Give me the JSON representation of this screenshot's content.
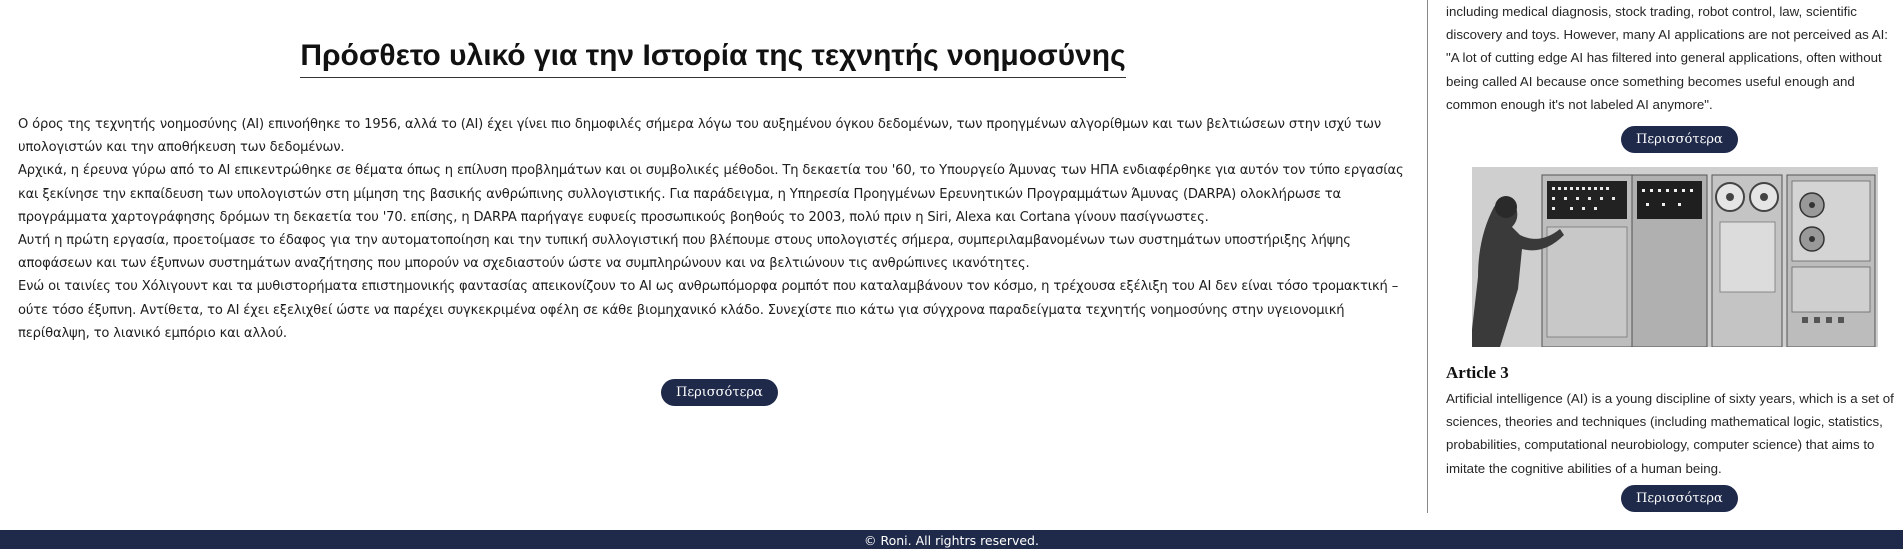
{
  "main": {
    "title": "Πρόσθετο υλικό για την Ιστορία της τεχνητής νοημοσύνης",
    "paragraphs": [
      "Ο όρος της τεχνητής νοημοσύνης (AI) επινοήθηκε το 1956, αλλά το (AI) έχει γίνει πιο δημοφιλές σήμερα λόγω του αυξημένου όγκου δεδομένων, των προηγμένων αλγορίθμων και των βελτιώσεων στην ισχύ των υπολογιστών και την αποθήκευση των δεδομένων.",
      "Αρχικά, η έρευνα γύρω από το AI επικεντρώθηκε σε θέματα όπως η επίλυση προβλημάτων και οι συμβολικές μέθοδοι. Τη δεκαετία του '60, το Υπουργείο Άμυνας των ΗΠΑ ενδιαφέρθηκε για αυτόν τον τύπο εργασίας και ξεκίνησε την εκπαίδευση των υπολογιστών στη μίμηση της βασικής ανθρώπινης συλλογιστικής. Για παράδειγμα, η Υπηρεσία Προηγμένων Ερευνητικών Προγραμμάτων Άμυνας (DARPA) ολοκλήρωσε τα προγράμματα χαρτογράφησης δρόμων τη δεκαετία του '70. επίσης, η DARPA παρήγαγε ευφυείς προσωπικούς βοηθούς το 2003, πολύ πριν η Siri, Alexa και Cortana γίνουν πασίγνωστες.",
      "Αυτή η πρώτη εργασία, προετοίμασε το έδαφος για την αυτοματοποίηση και την τυπική συλλογιστική που βλέπουμε στους υπολογιστές σήμερα, συμπεριλαμβανομένων των συστημάτων υποστήριξης λήψης αποφάσεων και των έξυπνων συστημάτων αναζήτησης που μπορούν να σχεδιαστούν ώστε να συμπληρώνουν και να βελτιώνουν τις ανθρώπινες ικανότητες.",
      "Ενώ οι ταινίες του Χόλιγουντ και τα μυθιστορήματα επιστημονικής φαντασίας απεικονίζουν το AI ως ανθρωπόμορφα ρομπότ που καταλαμβάνουν τον κόσμο, η τρέχουσα εξέλιξη του AI δεν είναι τόσο τρομακτική – ούτε τόσο έξυπνη. Αντίθετα, το AI έχει εξελιχθεί ώστε να παρέχει συγκεκριμένα οφέλη σε κάθε βιομηχανικό κλάδο. Συνεχίστε πιο κάτω για σύγχρονα παραδείγματα τεχνητής νοημοσύνης στην υγειονομική περίθαλψη, το λιανικό εμπόριο και αλλού."
    ],
    "more_label": "Περισσότερα"
  },
  "sidebar": {
    "article1_text": "including medical diagnosis, stock trading, robot control, law, scientific discovery and toys. However, many AI applications are not perceived as AI: \"A lot of cutting edge AI has filtered into general applications, often without being called AI because once something becomes useful enough and common enough it's not labeled AI anymore\".",
    "article1_more": "Περισσότερα",
    "article3_title": "Article 3",
    "article3_text": "Artificial intelligence (AI) is a young discipline of sixty years, which is a set of sciences, theories and techniques (including mathematical logic, statistics, probabilities, computational neurobiology, computer science) that aims to imitate the cognitive abilities of a human being.",
    "article3_more": "Περισσότερα"
  },
  "footer": {
    "text": "© Roni. All rightrs reserved."
  },
  "colors": {
    "accent": "#1f2a4a",
    "divider": "#888888"
  }
}
